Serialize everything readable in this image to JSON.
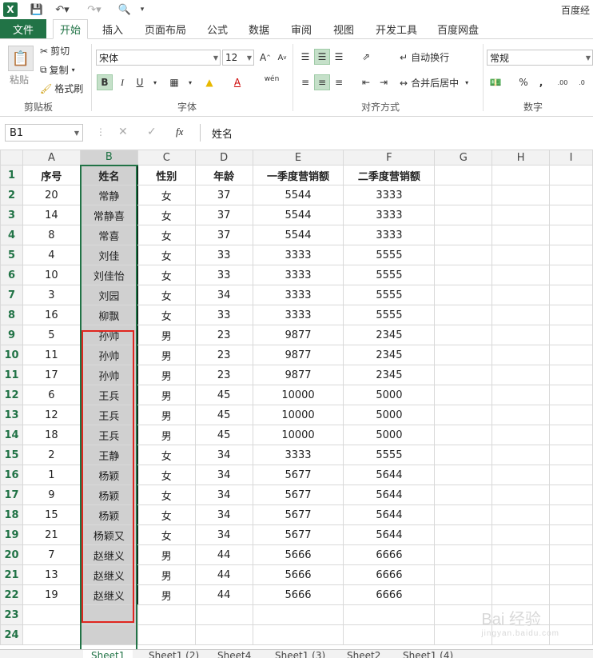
{
  "titlebar": {
    "app_title": "百度经"
  },
  "tabs": [
    "文件",
    "开始",
    "插入",
    "页面布局",
    "公式",
    "数据",
    "审阅",
    "视图",
    "开发工具",
    "百度网盘"
  ],
  "ribbon": {
    "clipboard": {
      "paste": "粘贴",
      "cut": "剪切",
      "copy": "复制",
      "format_painter": "格式刷",
      "label": "剪贴板"
    },
    "font": {
      "name": "宋体",
      "size": "12",
      "label": "字体",
      "bold": "B",
      "italic": "I",
      "underline": "U",
      "wen": "wén"
    },
    "alignment": {
      "wrap": "自动换行",
      "merge": "合并后居中",
      "label": "对齐方式"
    },
    "number": {
      "format": "常规",
      "label": "数字",
      "percent": "%",
      "comma": ","
    }
  },
  "formula_bar": {
    "namebox": "B1",
    "fx": "fx",
    "value": "姓名"
  },
  "columns": [
    "A",
    "B",
    "C",
    "D",
    "E",
    "F",
    "G",
    "H",
    "I"
  ],
  "headers": [
    "序号",
    "姓名",
    "性别",
    "年龄",
    "一季度营销额",
    "二季度营销额"
  ],
  "rows": [
    [
      "20",
      "常静",
      "女",
      "37",
      "5544",
      "3333"
    ],
    [
      "14",
      "常静喜",
      "女",
      "37",
      "5544",
      "3333"
    ],
    [
      "8",
      "常喜",
      "女",
      "37",
      "5544",
      "3333"
    ],
    [
      "4",
      "刘佳",
      "女",
      "33",
      "3333",
      "5555"
    ],
    [
      "10",
      "刘佳怡",
      "女",
      "33",
      "3333",
      "5555"
    ],
    [
      "3",
      "刘园",
      "女",
      "34",
      "3333",
      "5555"
    ],
    [
      "16",
      "柳飘",
      "女",
      "33",
      "3333",
      "5555"
    ],
    [
      "5",
      "孙帅",
      "男",
      "23",
      "9877",
      "2345"
    ],
    [
      "11",
      "孙帅",
      "男",
      "23",
      "9877",
      "2345"
    ],
    [
      "17",
      "孙帅",
      "男",
      "23",
      "9877",
      "2345"
    ],
    [
      "6",
      "王兵",
      "男",
      "45",
      "10000",
      "5000"
    ],
    [
      "12",
      "王兵",
      "男",
      "45",
      "10000",
      "5000"
    ],
    [
      "18",
      "王兵",
      "男",
      "45",
      "10000",
      "5000"
    ],
    [
      "2",
      "王静",
      "女",
      "34",
      "3333",
      "5555"
    ],
    [
      "1",
      "杨颖",
      "女",
      "34",
      "5677",
      "5644"
    ],
    [
      "9",
      "杨颖",
      "女",
      "34",
      "5677",
      "5644"
    ],
    [
      "15",
      "杨颖",
      "女",
      "34",
      "5677",
      "5644"
    ],
    [
      "21",
      "杨颖又",
      "女",
      "34",
      "5677",
      "5644"
    ],
    [
      "7",
      "赵继义",
      "男",
      "44",
      "5666",
      "6666"
    ],
    [
      "13",
      "赵继义",
      "男",
      "44",
      "5666",
      "6666"
    ],
    [
      "19",
      "赵继义",
      "男",
      "44",
      "5666",
      "6666"
    ]
  ],
  "row_numbers": [
    "1",
    "2",
    "3",
    "4",
    "5",
    "6",
    "7",
    "8",
    "9",
    "10",
    "11",
    "12",
    "13",
    "14",
    "15",
    "16",
    "17",
    "18",
    "19",
    "20",
    "21",
    "22",
    "23",
    "24"
  ],
  "sheets": [
    "Sheet1",
    "Sheet1 (2)",
    "Sheet4",
    "Sheet1 (3)",
    "Sheet2",
    "Sheet1 (4)"
  ],
  "watermark": {
    "text": "Bai 经验",
    "sub": "jingyan.baidu.com"
  },
  "colors": {
    "accent": "#217346",
    "highlight": "#e0261f",
    "selected_col": "#d0d0d0"
  }
}
